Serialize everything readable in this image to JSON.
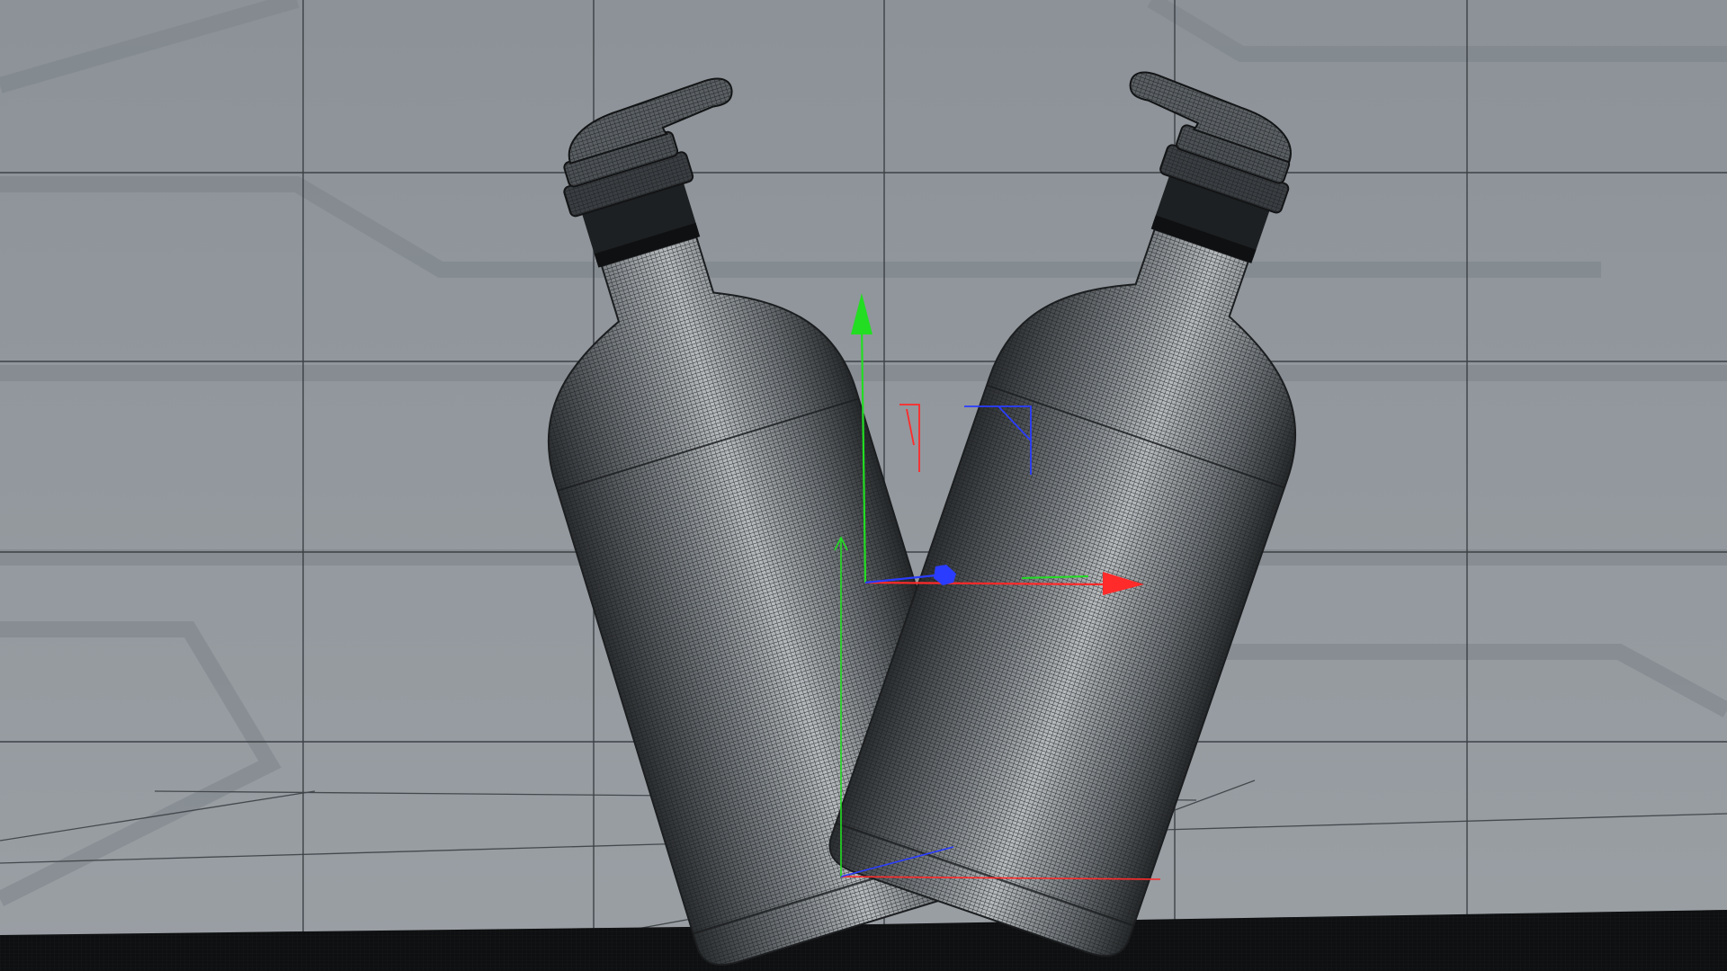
{
  "viewport": {
    "camera": "",
    "background_color": "#8e949a",
    "grid_color": "#2e3338",
    "floor_color": "#0e0f10",
    "wire_color": "#1b1d1f",
    "shade_dark": "#1f2224",
    "shade_mid": "#6d7276",
    "shade_light": "#b8bcbf"
  },
  "objects": [
    {
      "name": "left-bottle",
      "type": "pump-bottle-mesh",
      "tilt": "left"
    },
    {
      "name": "right-bottle",
      "type": "pump-bottle-mesh",
      "tilt": "right"
    }
  ],
  "gizmo": {
    "x_axis_color": "#ff2a2a",
    "y_axis_color": "#22dd22",
    "z_axis_color": "#2a3cff",
    "icons": [
      "move-gizmo-icon",
      "scale-handle-icon",
      "rotate-handle-icon"
    ]
  }
}
